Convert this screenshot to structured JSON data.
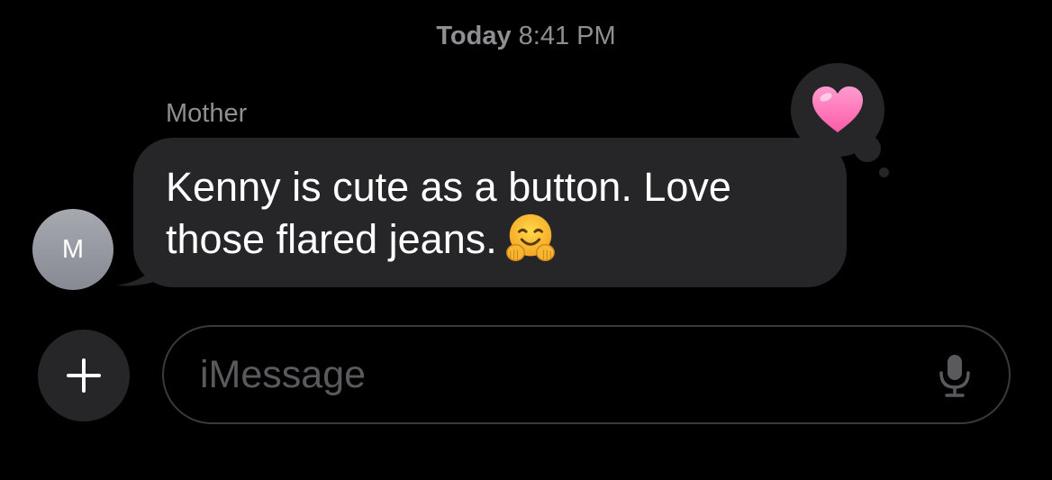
{
  "header": {
    "day": "Today",
    "time": "8:41 PM"
  },
  "conversation": {
    "sender_name": "Mother",
    "avatar_initial": "M",
    "message": {
      "text": "Kenny is cute as a button. Love those flared jeans.",
      "emoji": "smiling-face-with-open-hands",
      "tapback": "heart"
    }
  },
  "composer": {
    "placeholder": "iMessage",
    "plus_icon": "plus-icon",
    "mic_icon": "microphone-icon"
  },
  "colors": {
    "background": "#000000",
    "bubble": "#262629",
    "secondary_text": "#8e8e93",
    "heart": "#ff6fb0",
    "avatar": "#9a9ca4"
  }
}
